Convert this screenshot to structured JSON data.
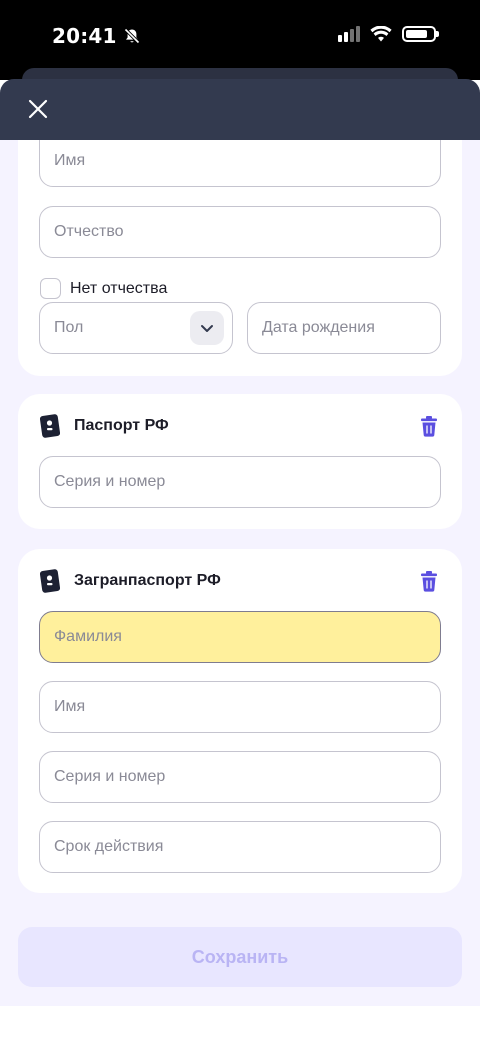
{
  "status_bar": {
    "time": "20:41"
  },
  "form": {
    "first_name_placeholder": "Имя",
    "patronymic_placeholder": "Отчество",
    "no_patronymic_label": "Нет отчества",
    "gender_placeholder": "Пол",
    "birth_date_placeholder": "Дата рождения"
  },
  "passport_rf": {
    "title": "Паспорт РФ",
    "number_placeholder": "Серия и номер"
  },
  "foreign_passport": {
    "title": "Загранпаспорт РФ",
    "last_name_placeholder": "Фамилия",
    "first_name_placeholder": "Имя",
    "number_placeholder": "Серия и номер",
    "expiry_placeholder": "Срок действия"
  },
  "save_label": "Сохранить",
  "colors": {
    "header_bg": "#333a4f",
    "accent": "#5b4fe0",
    "highlight": "#fff09c",
    "save_bg": "#e8e6ff",
    "save_text": "#b9b4f4"
  }
}
